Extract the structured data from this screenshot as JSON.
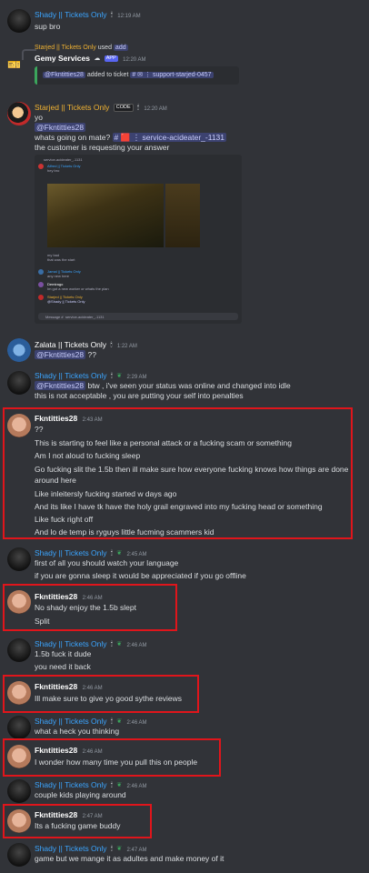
{
  "messages": [
    {
      "id": "m1",
      "author": "Shady || Tickets Only",
      "time": "12:19 AM",
      "lines": [
        "sup bro"
      ]
    },
    {
      "id": "m2",
      "sys_author": "Starjed || Tickets Only",
      "sys_used": "used",
      "sys_command": "add",
      "author": "Gemy Services",
      "badge": "APP",
      "time": "12:20 AM",
      "embed_mention": "@Fkntitties28",
      "embed_text": "added to ticket",
      "embed_channel": "support-starjed-0457"
    },
    {
      "id": "m3",
      "author": "Starjed || Tickets Only",
      "badge": "CODE",
      "time": "12:20 AM",
      "lines": [
        "yo",
        "whats going on mate?",
        "the customer is requesting your answer"
      ],
      "mention": "@Fkntitties28",
      "channel": "service-acideater_-1131"
    },
    {
      "id": "m4",
      "author": "Zalata || Tickets Only",
      "time": "1:22 AM",
      "mention": "@Fkntitties28",
      "suffix": "??"
    },
    {
      "id": "m5",
      "author": "Shady || Tickets Only",
      "time": "2:29 AM",
      "mention": "@Fkntitties28",
      "lines": [
        "btw , i've seen your status was online and changed into idle",
        "this is not acceptable , you are putting your self into  penalties"
      ]
    },
    {
      "id": "m6",
      "author": "Fkntitties28",
      "time": "2:43 AM",
      "lines": [
        "??",
        "This is starting to feel like a personal attack or a fucking scam or something",
        "Am I not aloud to fucking sleep",
        "Go fucking slit the 1.5b then ill make sure how everyone fucking knows how things are done",
        "around here",
        "Like inleitersly fucking started w days ago",
        "And its like I have tk have the holy grail engraved into my fucking head or something",
        "Like fuck right off",
        "And lo de temp is ryguys little fucming scammers kid"
      ]
    },
    {
      "id": "m7",
      "author": "Shady || Tickets Only",
      "time": "2:45 AM",
      "lines": [
        "first of all you should watch your language",
        "if you are gonna sleep it would be appreciated if you go offline"
      ]
    },
    {
      "id": "m8",
      "author": "Fkntitties28",
      "time": "2:46 AM",
      "lines": [
        "No shady enjoy the 1.5b slept",
        "Split"
      ]
    },
    {
      "id": "m9",
      "author": "Shady || Tickets Only",
      "time": "2:46 AM",
      "lines": [
        "1.5b fuck it dude",
        "you need it back"
      ]
    },
    {
      "id": "m10",
      "author": "Fkntitties28",
      "time": "2:46 AM",
      "lines": [
        "Ill make sure to give yo good sythe reviews"
      ]
    },
    {
      "id": "m11",
      "author": "Shady || Tickets Only",
      "time": "2:46 AM",
      "lines": [
        "what a heck you thinking"
      ]
    },
    {
      "id": "m12",
      "author": "Fkntitties28",
      "time": "2:46 AM",
      "lines": [
        "I wonder how many time you pull this on people"
      ]
    },
    {
      "id": "m13",
      "author": "Shady || Tickets Only",
      "time": "2:46 AM",
      "lines": [
        "couple kids playing around"
      ]
    },
    {
      "id": "m14",
      "author": "Fkntitties28",
      "time": "2:47 AM",
      "lines": [
        "Its a fucking game buddy"
      ]
    },
    {
      "id": "m15",
      "author": "Shady || Tickets Only",
      "time": "2:47 AM",
      "lines": [
        "game but we mange it as adultes and make money of it"
      ]
    }
  ],
  "screenshot": {
    "channel": "service-acideater_-1131",
    "lines": [
      "Alfred || Tickets Only",
      "hey bro",
      "my bad",
      "that was the start",
      "Jamal || Tickets Only",
      "any new here",
      "Demirago",
      "Im got a new worker or whats the plan",
      "Starjed || Tickets Only",
      "@Shady || Tickets Only",
      "Message #",
      "service-acideater_-1131"
    ]
  }
}
